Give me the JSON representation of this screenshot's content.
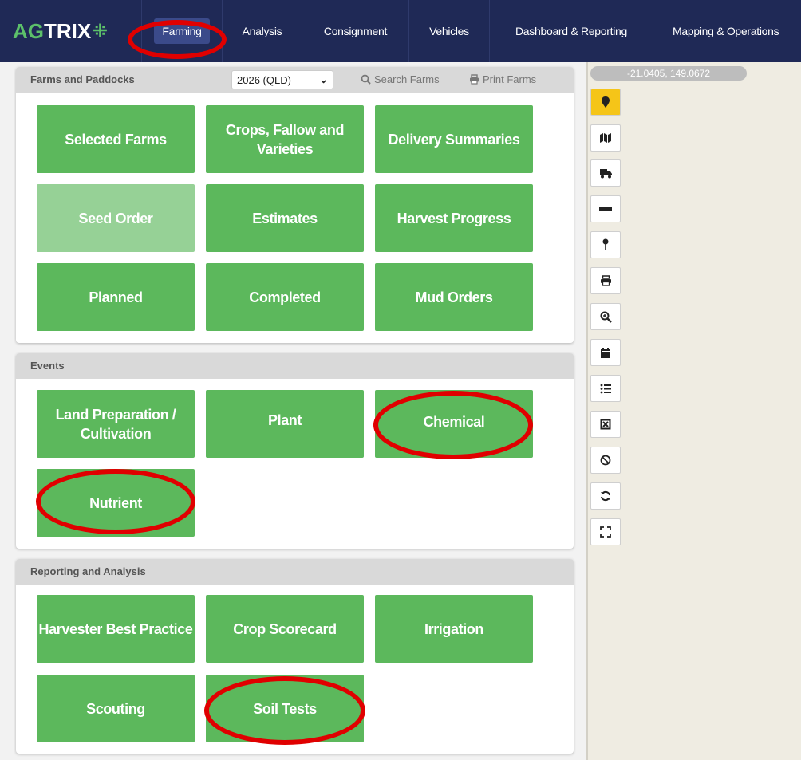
{
  "brand": {
    "logo_ag": "AG",
    "logo_trix": "TRIX",
    "logo_mark": "⁜"
  },
  "nav": {
    "tabs": [
      {
        "label": "Farming",
        "active": true
      },
      {
        "label": "Analysis"
      },
      {
        "label": "Consignment"
      },
      {
        "label": "Vehicles"
      },
      {
        "label": "Dashboard & Reporting"
      },
      {
        "label": "Mapping & Operations"
      }
    ]
  },
  "farms_panel": {
    "title": "Farms and Paddocks",
    "season_select": "2026 (QLD)",
    "search_label": "Search Farms",
    "print_label": "Print Farms",
    "tiles": [
      "Selected Farms",
      "Crops, Fallow and Varieties",
      "Delivery Summaries",
      "Seed Order",
      "Estimates",
      "Harvest Progress",
      "Planned",
      "Completed",
      "Mud Orders"
    ]
  },
  "events_panel": {
    "title": "Events",
    "tiles": [
      "Land Preparation / Cultivation",
      "Plant",
      "Chemical",
      "Nutrient"
    ]
  },
  "reporting_panel": {
    "title": "Reporting and Analysis",
    "tiles": [
      "Harvester Best Practice",
      "Crop Scorecard",
      "Irrigation",
      "Scouting",
      "Soil Tests"
    ]
  },
  "map": {
    "coordinates": "-21.0405, 149.0672",
    "toolbar": [
      {
        "icon": "map-marker-icon",
        "active": true
      },
      {
        "icon": "map-icon"
      },
      {
        "icon": "truck-icon"
      },
      {
        "icon": "ruler-icon"
      },
      {
        "icon": "pin-icon"
      },
      {
        "icon": "print-icon"
      },
      {
        "icon": "zoom-in-icon"
      },
      {
        "icon": "calendar-icon"
      },
      {
        "icon": "list-icon"
      },
      {
        "icon": "select-area-icon"
      },
      {
        "icon": "cancel-icon"
      },
      {
        "icon": "refresh-icon"
      },
      {
        "icon": "fullscreen-icon"
      }
    ]
  },
  "colors": {
    "nav_bg": "#1f2956",
    "tile_green": "#5cb85c",
    "tile_disabled": "#96d196",
    "highlight_red": "#e00000",
    "active_tool": "#f5c518"
  }
}
